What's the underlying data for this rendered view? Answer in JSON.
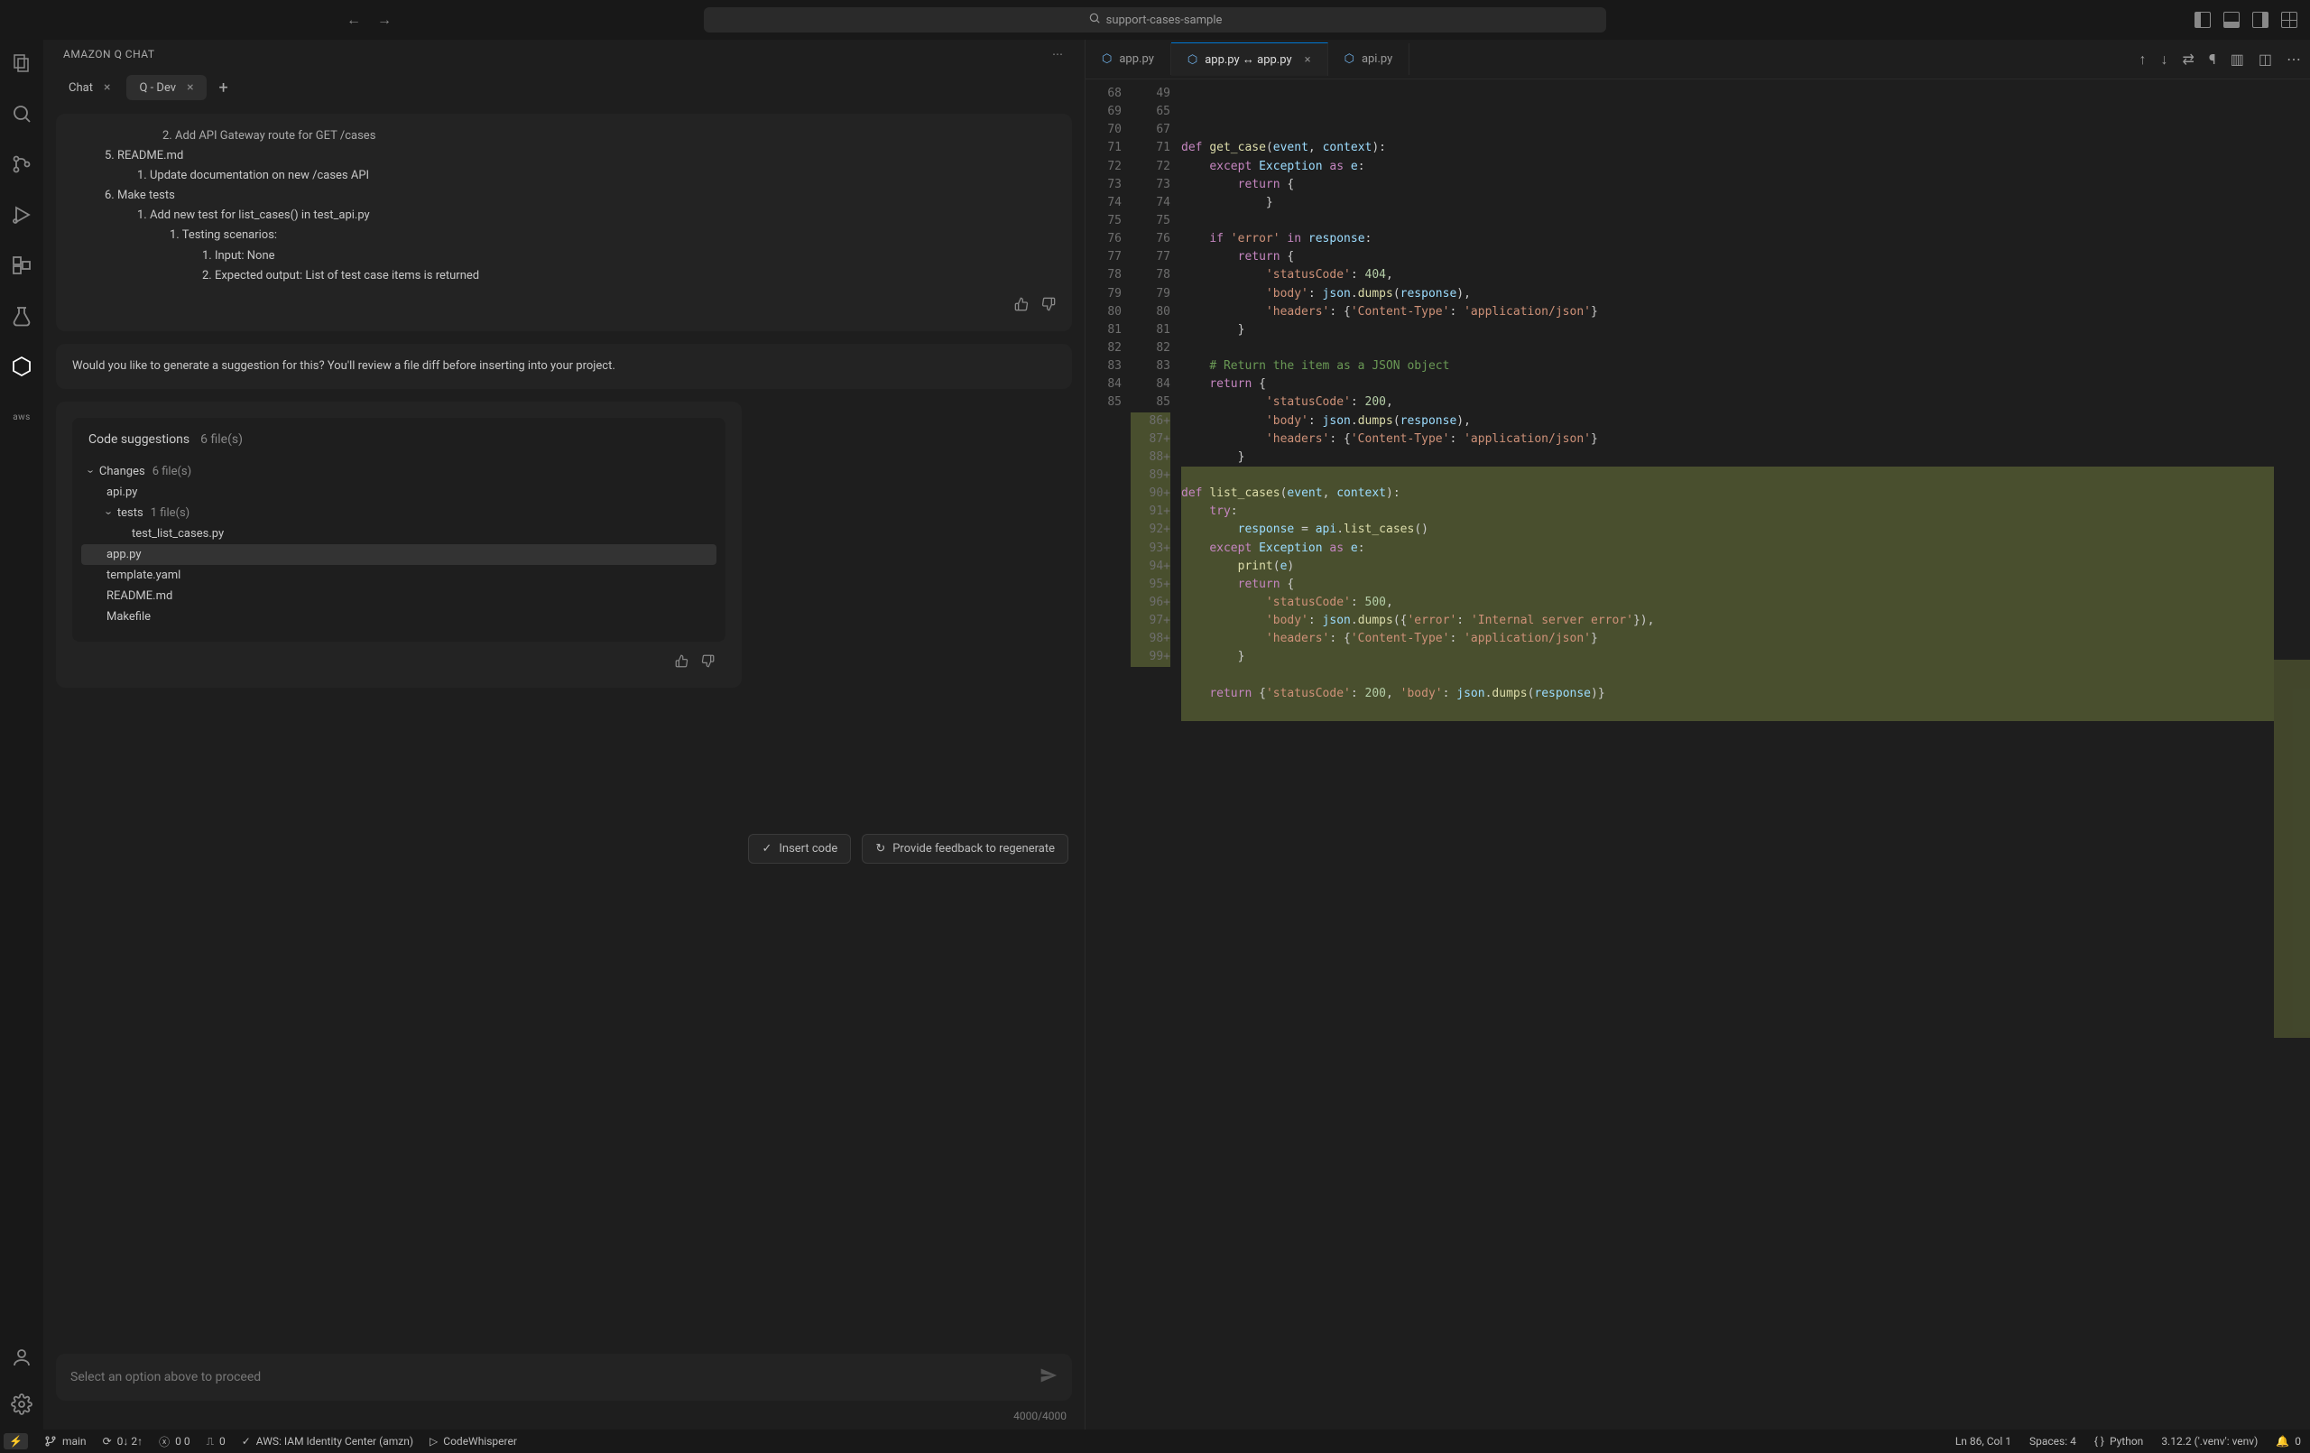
{
  "titlebar": {
    "search_text": "support-cases-sample"
  },
  "panel": {
    "title": "AMAZON Q  CHAT",
    "tabs": [
      {
        "label": "Chat",
        "active": false
      },
      {
        "label": "Q - Dev",
        "active": true
      }
    ],
    "plan": {
      "l1": "2. Add API Gateway route for GET /cases",
      "l2_no": "5.",
      "l2": "README.md",
      "l3": "1. Update documentation on new /cases API",
      "l4_no": "6.",
      "l4": "Make tests",
      "l5": "1. Add new test for list_cases() in test_api.py",
      "l6": "1. Testing scenarios:",
      "l7": "1. Input: None",
      "l8": "2. Expected output: List of test case items is returned"
    },
    "prompt_text": "Would you like to generate a suggestion for this? You'll review a file diff before inserting into your project.",
    "suggestions": {
      "title": "Code suggestions",
      "count": "6 file(s)",
      "changes_label": "Changes",
      "changes_count": "6 file(s)",
      "tests_label": "tests",
      "tests_count": "1 file(s)",
      "files": {
        "api": "api.py",
        "test_list": "test_list_cases.py",
        "app": "app.py",
        "template": "template.yaml",
        "readme": "README.md",
        "makefile": "Makefile"
      }
    },
    "actions": {
      "insert": "Insert code",
      "feedback": "Provide feedback to regenerate"
    },
    "input_placeholder": "Select an option above to proceed",
    "char_count": "4000/4000"
  },
  "editor": {
    "tabs": [
      {
        "label": "app.py",
        "active": false
      },
      {
        "label": "app.py ↔ app.py",
        "active": true
      },
      {
        "label": "api.py",
        "active": false
      }
    ],
    "lines": [
      {
        "lg": "68",
        "rg": "49",
        "add": false,
        "html": "<span class='kw'>def</span> <span class='fn'>get_case</span>(<span class='id'>event</span>, <span class='id'>context</span>):"
      },
      {
        "lg": "69",
        "rg": "65",
        "add": false,
        "html": "    <span class='kw'>except</span> <span class='id'>Exception</span> <span class='kw'>as</span> <span class='id'>e</span>:"
      },
      {
        "lg": "70",
        "rg": "67",
        "add": false,
        "html": "        <span class='kw'>return</span> {"
      },
      {
        "lg": "71",
        "rg": "71",
        "add": false,
        "html": "            }"
      },
      {
        "lg": "72",
        "rg": "72",
        "add": false,
        "html": ""
      },
      {
        "lg": "73",
        "rg": "73",
        "add": false,
        "html": "    <span class='kw'>if</span> <span class='st'>'error'</span> <span class='kw'>in</span> <span class='id'>response</span>:"
      },
      {
        "lg": "74",
        "rg": "74",
        "add": false,
        "html": "        <span class='kw'>return</span> {"
      },
      {
        "lg": "75",
        "rg": "75",
        "add": false,
        "html": "            <span class='st'>'statusCode'</span>: <span class='nm'>404</span>,"
      },
      {
        "lg": "76",
        "rg": "76",
        "add": false,
        "html": "            <span class='st'>'body'</span>: <span class='id'>json</span>.<span class='fn'>dumps</span>(<span class='id'>response</span>),"
      },
      {
        "lg": "77",
        "rg": "77",
        "add": false,
        "html": "            <span class='st'>'headers'</span>: {<span class='st'>'Content-Type'</span>: <span class='st'>'application/json'</span>}"
      },
      {
        "lg": "78",
        "rg": "78",
        "add": false,
        "html": "        }"
      },
      {
        "lg": "79",
        "rg": "79",
        "add": false,
        "html": ""
      },
      {
        "lg": "80",
        "rg": "80",
        "add": false,
        "html": "    <span class='cm'># Return the item as a JSON object</span>"
      },
      {
        "lg": "81",
        "rg": "81",
        "add": false,
        "html": "    <span class='kw'>return</span> {"
      },
      {
        "lg": "82",
        "rg": "82",
        "add": false,
        "html": "            <span class='st'>'statusCode'</span>: <span class='nm'>200</span>,"
      },
      {
        "lg": "83",
        "rg": "83",
        "add": false,
        "html": "            <span class='st'>'body'</span>: <span class='id'>json</span>.<span class='fn'>dumps</span>(<span class='id'>response</span>),"
      },
      {
        "lg": "84",
        "rg": "84",
        "add": false,
        "html": "            <span class='st'>'headers'</span>: {<span class='st'>'Content-Type'</span>: <span class='st'>'application/json'</span>}"
      },
      {
        "lg": "85",
        "rg": "85",
        "add": false,
        "html": "        }"
      },
      {
        "lg": "",
        "rg": "86+",
        "add": true,
        "html": ""
      },
      {
        "lg": "",
        "rg": "87+",
        "add": true,
        "html": "<span class='kw'>def</span> <span class='fn'>list_cases</span>(<span class='id'>event</span>, <span class='id'>context</span>):"
      },
      {
        "lg": "",
        "rg": "88+",
        "add": true,
        "html": "    <span class='kw'>try</span>:"
      },
      {
        "lg": "",
        "rg": "89+",
        "add": true,
        "html": "        <span class='id'>response</span> = <span class='id'>api</span>.<span class='fn'>list_cases</span>()"
      },
      {
        "lg": "",
        "rg": "90+",
        "add": true,
        "html": "    <span class='kw'>except</span> <span class='id'>Exception</span> <span class='kw'>as</span> <span class='id'>e</span>:"
      },
      {
        "lg": "",
        "rg": "91+",
        "add": true,
        "html": "        <span class='fn'>print</span>(<span class='id'>e</span>)"
      },
      {
        "lg": "",
        "rg": "92+",
        "add": true,
        "html": "        <span class='kw'>return</span> {"
      },
      {
        "lg": "",
        "rg": "93+",
        "add": true,
        "html": "            <span class='st'>'statusCode'</span>: <span class='nm'>500</span>,"
      },
      {
        "lg": "",
        "rg": "94+",
        "add": true,
        "html": "            <span class='st'>'body'</span>: <span class='id'>json</span>.<span class='fn'>dumps</span>({<span class='st'>'error'</span>: <span class='st'>'Internal server error'</span>}),"
      },
      {
        "lg": "",
        "rg": "95+",
        "add": true,
        "html": "            <span class='st'>'headers'</span>: {<span class='st'>'Content-Type'</span>: <span class='st'>'application/json'</span>}"
      },
      {
        "lg": "",
        "rg": "96+",
        "add": true,
        "html": "        }"
      },
      {
        "lg": "",
        "rg": "97+",
        "add": true,
        "html": ""
      },
      {
        "lg": "",
        "rg": "98+",
        "add": true,
        "html": "    <span class='kw'>return</span> {<span class='st'>'statusCode'</span>: <span class='nm'>200</span>, <span class='st'>'body'</span>: <span class='id'>json</span>.<span class='fn'>dumps</span>(<span class='id'>response</span>)}"
      },
      {
        "lg": "",
        "rg": "99+",
        "add": true,
        "html": ""
      }
    ]
  },
  "statusbar": {
    "branch": "main",
    "sync": "0↓ 2↑",
    "problems": "0  0",
    "ports": "0",
    "aws": "AWS: IAM Identity Center (amzn)",
    "whisperer": "CodeWhisperer",
    "pos": "Ln 86, Col 1",
    "spaces": "Spaces: 4",
    "lang": "Python",
    "py": "3.12.2 ('.venv': venv)",
    "bell": "0"
  }
}
